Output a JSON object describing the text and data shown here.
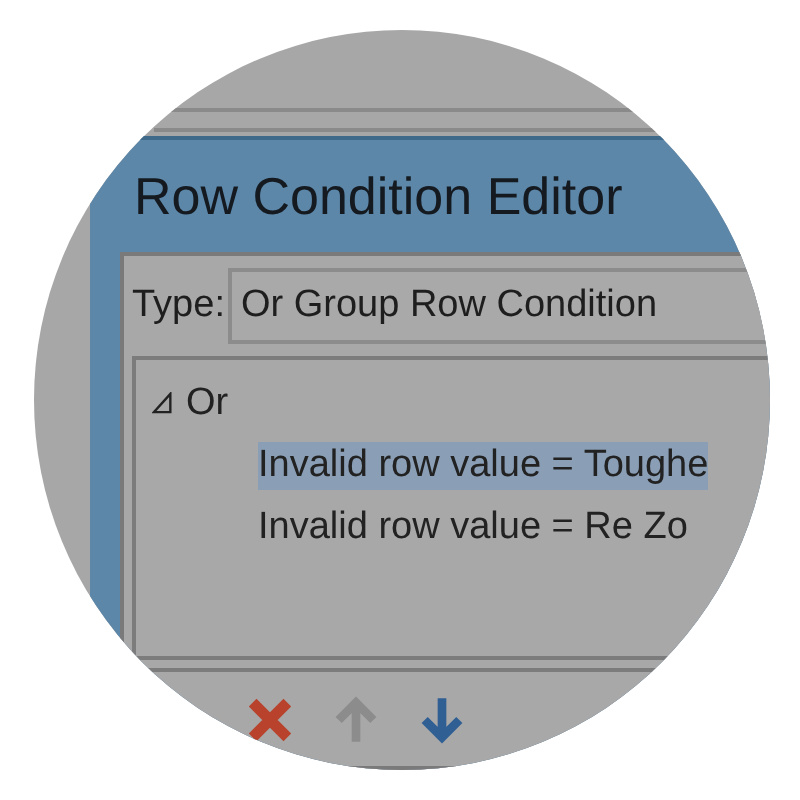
{
  "window": {
    "title": "Row Condition Editor"
  },
  "type_field": {
    "label": "Type:",
    "value": "Or Group Row Condition"
  },
  "tree": [
    {
      "label": "Or",
      "expanded": true,
      "selected": false,
      "children": [
        {
          "label": "Invalid row value = Toughe",
          "selected": true
        },
        {
          "label": "Invalid row value = Re Zo",
          "selected": false
        }
      ]
    }
  ],
  "toolbar": [
    {
      "kind": "delete",
      "disabled": false
    },
    {
      "kind": "up",
      "disabled": true
    },
    {
      "kind": "down",
      "disabled": false
    }
  ]
}
